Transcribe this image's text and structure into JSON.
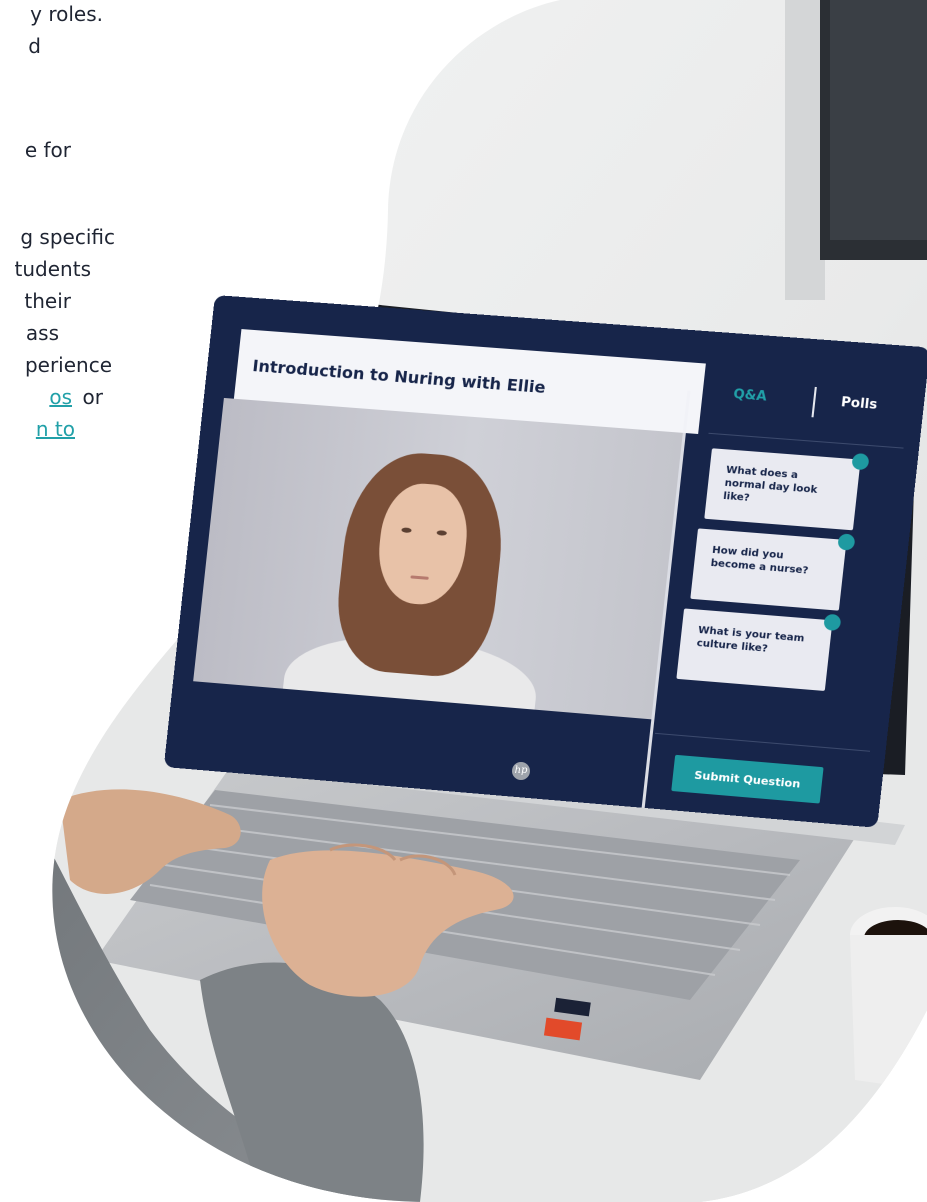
{
  "left_text": {
    "lines": [
      {
        "text": "y roles.",
        "link": false
      },
      {
        "text": "d",
        "link": false
      },
      {
        "text": "e for",
        "link": false
      },
      {
        "text": "g specific",
        "link": false
      },
      {
        "text": "tudents",
        "link": false
      },
      {
        "text": "their",
        "link": false
      },
      {
        "text": "ass",
        "link": false
      },
      {
        "text": "perience",
        "link": false
      },
      {
        "text": "os",
        "link": true
      },
      {
        "text": "or",
        "link": false
      },
      {
        "text": "n to",
        "link": true
      }
    ]
  },
  "screen": {
    "title": "Introduction to Nuring with Ellie",
    "tabs": {
      "qa": "Q&A",
      "polls": "Polls"
    },
    "questions": [
      "What does a normal day look like?",
      "How did you become a nurse?",
      "What is your team culture like?"
    ],
    "submit_label": "Submit Question"
  },
  "colors": {
    "navy": "#17254a",
    "teal": "#1e9aa1",
    "text_dark": "#1f2533"
  },
  "icons": [
    "hp-logo-icon"
  ]
}
